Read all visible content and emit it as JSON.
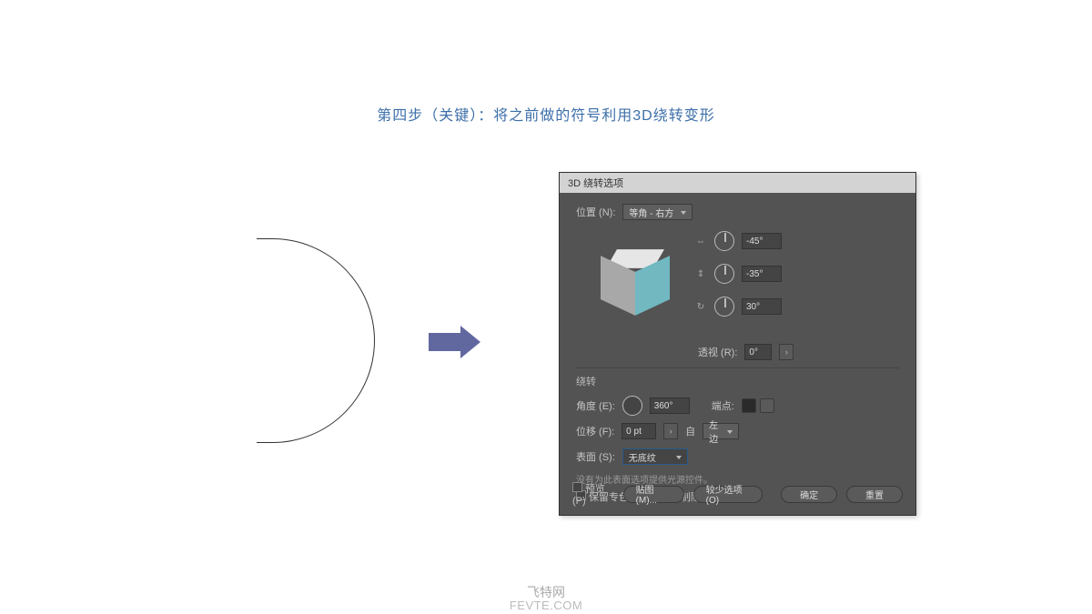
{
  "instruction": "第四步（关键）：将之前做的符号利用3D绕转变形",
  "dialog": {
    "title": "3D 绕转选项",
    "position_label": "位置 (N):",
    "position_value": "等角 - 右方",
    "angles": {
      "x": "-45°",
      "y": "-35°",
      "z": "30°"
    },
    "perspective_label": "透视 (R):",
    "perspective_value": "0°",
    "lathe_section": "绕转",
    "angle_label": "角度 (E):",
    "angle_value": "360°",
    "edge_label": "端点:",
    "offset_label": "位移 (F):",
    "offset_value": "0 pt",
    "from_label": "自",
    "from_value": "左边",
    "surface_label": "表面 (S):",
    "surface_value": "无底纹",
    "surface_hint": "没有为此表面选项提供光源控件。",
    "preserve_spot": "保留专色 (V)",
    "draw_hidden": "绘制隐藏表面",
    "preview": "预览 (P)",
    "map_art": "贴图 (M)...",
    "fewer_options": "较少选项 (O)",
    "ok": "确定",
    "reset": "重置"
  },
  "watermark": {
    "line1": "飞特网",
    "line2": "FEVTE.COM"
  }
}
